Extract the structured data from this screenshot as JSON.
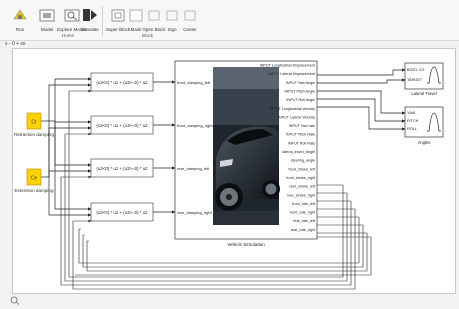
{
  "toolbar": {
    "buttons": [
      {
        "name": "run-button",
        "label": "Run"
      },
      {
        "name": "model-button",
        "label": "Model"
      },
      {
        "name": "explore-button",
        "label": "Explore Modes"
      },
      {
        "name": "simulate-button",
        "label": "Simulate"
      },
      {
        "name": "super-block-button",
        "label": "Super Block"
      },
      {
        "name": "mask-button",
        "label": "Mask"
      },
      {
        "name": "open-button",
        "label": "Open Block"
      },
      {
        "name": "sign-button",
        "label": "Sign"
      },
      {
        "name": "center-button",
        "label": "Center"
      }
    ],
    "groups": [
      "Home",
      "Block"
    ]
  },
  "breadcrumb": "x - 0 + xe",
  "diagram": {
    "inputs": [
      {
        "label": "Cr",
        "caption": "Retraction damping"
      },
      {
        "label": "Ce",
        "caption": "Extension damping"
      }
    ],
    "fcn_expr": "(u3<0) * u1 + (u3>=0) * u2",
    "fcn_count": 4,
    "subsystem_inputs": [
      "front_damping_left",
      "front_damping_right",
      "rear_damping_left",
      "rear_damping_right"
    ],
    "subsystem_outputs": [
      "INPUT Longitudinal Displacement",
      "INPUT Lateral Displacement",
      "INPUT Yaw Angle",
      "INPUT Pitch Angle",
      "INPUT Roll Angle",
      "INPUT Longitudinal velocity",
      "INPUT Lateral Velocity",
      "INPUT Yaw rate",
      "INPUT Pitch Rate",
      "INPUT Roll Rate",
      "lateral_travel_target",
      "steering_angle",
      "front_stroke_left",
      "front_stroke_right",
      "rear_stroke_left",
      "rear_stroke_right",
      "front_rate_left",
      "front_rate_right",
      "rear_rate_left",
      "rear_rate_right"
    ],
    "subsystem_caption": "Vehicle Simulation",
    "scope1": {
      "inputs": [
        "BODY CG",
        "TARGET"
      ],
      "caption": "Lateral Travel"
    },
    "scope2": {
      "inputs": [
        "YAW",
        "PITCH",
        "ROLL"
      ],
      "caption": "Angles"
    },
    "colors": {
      "gain": "#ffd200",
      "wire": "#222222",
      "block_border": "#333333"
    }
  }
}
